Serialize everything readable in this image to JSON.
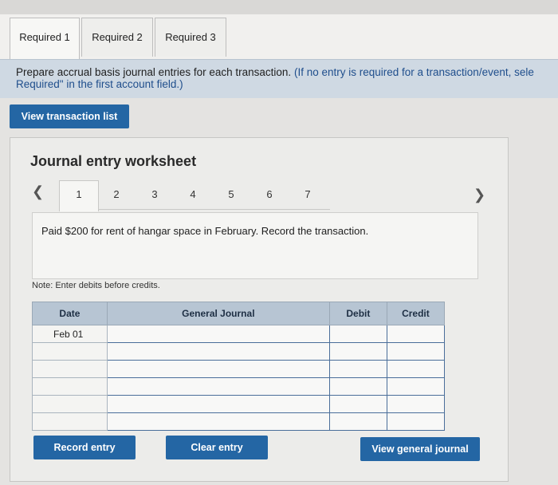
{
  "tabs": [
    {
      "label": "Required 1"
    },
    {
      "label": "Required 2"
    },
    {
      "label": "Required 3"
    }
  ],
  "instructions": {
    "main": "Prepare accrual basis journal entries for each transaction.",
    "note_line1": "(If no entry is required for a transaction/event, sele",
    "note_line2": "Required\" in the first account field.)"
  },
  "view_transaction_list_label": "View transaction list",
  "worksheet": {
    "title": "Journal entry worksheet",
    "prev_icon": "chevron-left-icon",
    "next_icon": "chevron-right-icon",
    "steps": [
      "1",
      "2",
      "3",
      "4",
      "5",
      "6",
      "7"
    ],
    "active_step": "1",
    "description": "Paid $200 for rent of hangar space in February. Record the transaction.",
    "note": "Note: Enter debits before credits."
  },
  "table": {
    "headers": {
      "date": "Date",
      "general_journal": "General Journal",
      "debit": "Debit",
      "credit": "Credit"
    },
    "rows": [
      {
        "date": "Feb 01",
        "account": "",
        "debit": "",
        "credit": ""
      },
      {
        "date": "",
        "account": "",
        "debit": "",
        "credit": ""
      },
      {
        "date": "",
        "account": "",
        "debit": "",
        "credit": ""
      },
      {
        "date": "",
        "account": "",
        "debit": "",
        "credit": ""
      },
      {
        "date": "",
        "account": "",
        "debit": "",
        "credit": ""
      },
      {
        "date": "",
        "account": "",
        "debit": "",
        "credit": ""
      }
    ]
  },
  "buttons": {
    "record_entry": "Record entry",
    "clear_entry": "Clear entry",
    "view_general_journal": "View general journal"
  },
  "colors": {
    "button_blue": "#2466a4",
    "table_header": "#b7c5d3"
  }
}
